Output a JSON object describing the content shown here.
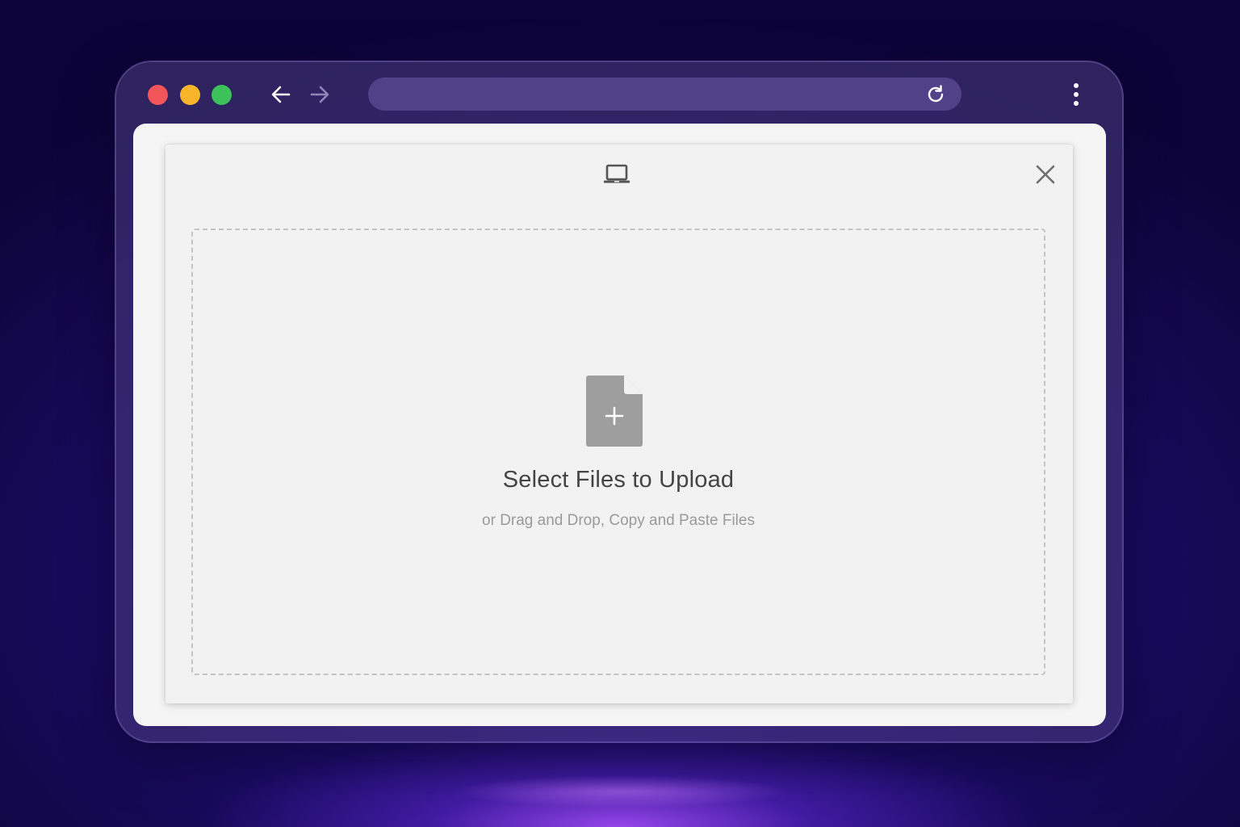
{
  "browser": {
    "address_bar": {
      "url": ""
    },
    "icons": {
      "back": "arrow-left-icon",
      "forward": "arrow-right-icon",
      "reload": "reload-icon",
      "menu": "kebab-menu-icon"
    },
    "traffic_lights": {
      "close_color": "#f2565a",
      "minimize_color": "#f9b52a",
      "maximize_color": "#3dc15a"
    }
  },
  "upload_dialog": {
    "source_icon": "laptop-icon",
    "close_icon": "close-icon",
    "file_icon": "file-plus-icon",
    "title": "Select Files to Upload",
    "subtitle": "or Drag and Drop, Copy and Paste Files"
  },
  "colors": {
    "background": "#120748",
    "glow": "#aa50ff",
    "window_chrome": "#4a3c80",
    "dialog_background": "#f2f2f2",
    "icon_gray": "#9e9e9e",
    "title_text": "#444444",
    "subtitle_text": "#9a9a9a"
  }
}
